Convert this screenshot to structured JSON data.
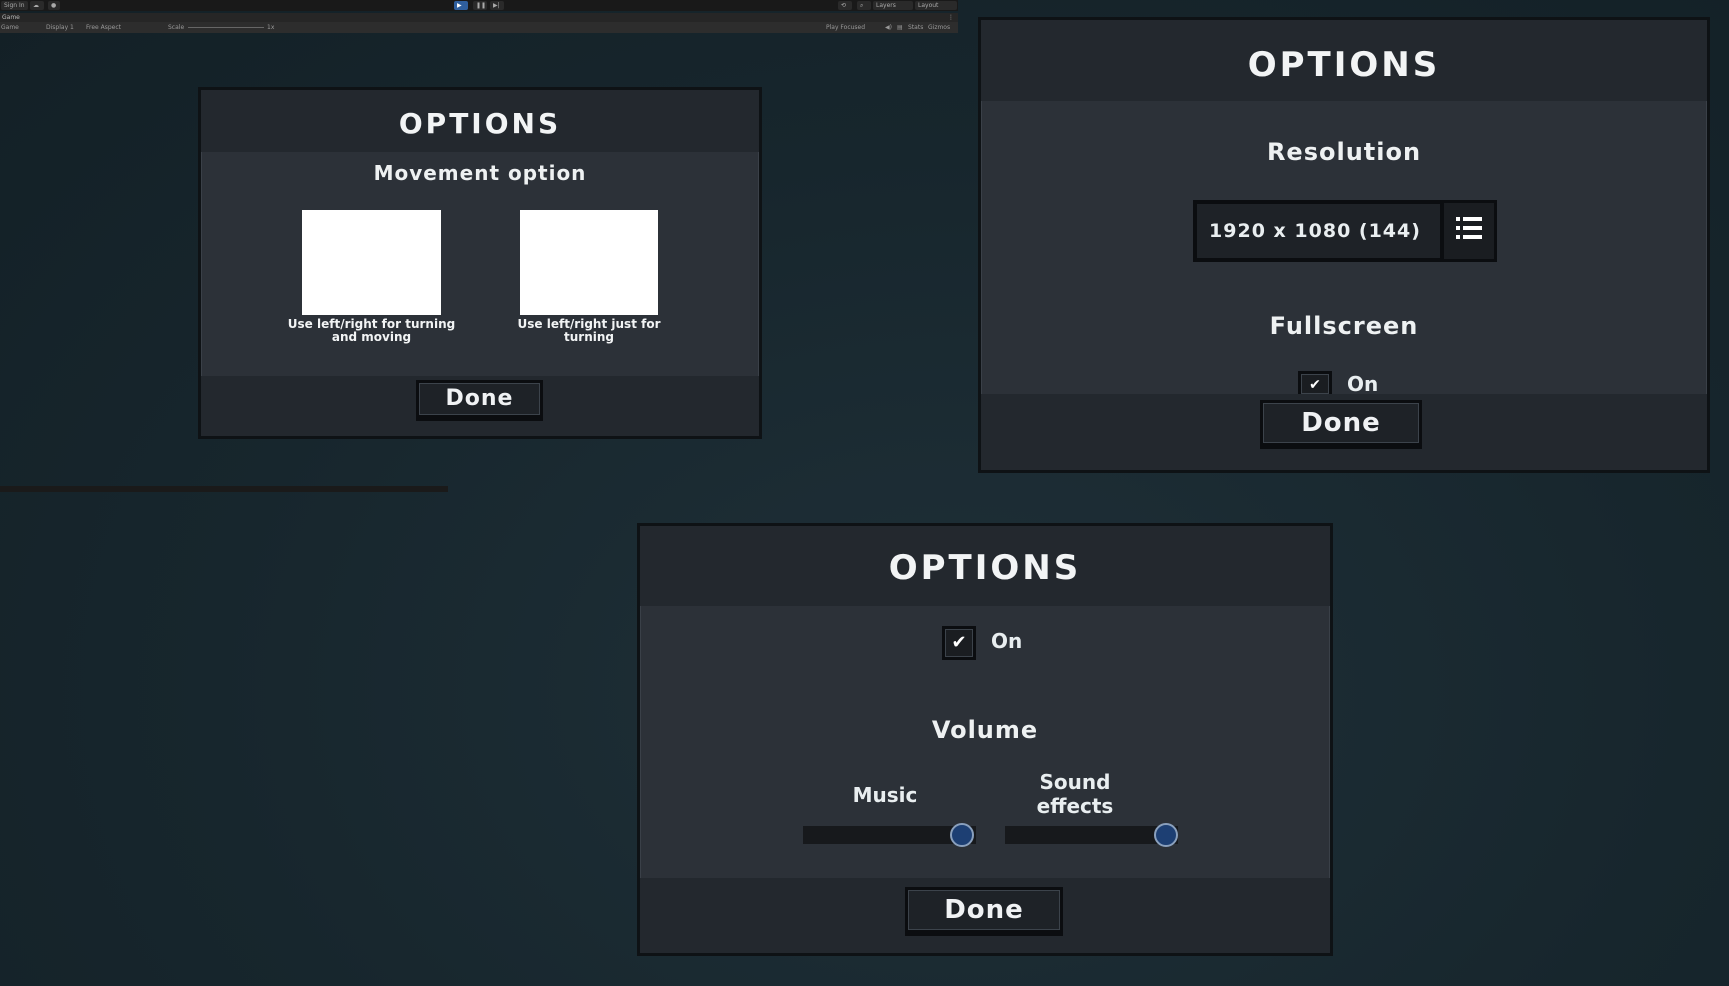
{
  "editor": {
    "sign_in": "Sign In",
    "layers": "Layers",
    "layout": "Layout",
    "tab_game": "Game",
    "game_view": "Game",
    "display": "Display 1",
    "aspect": "Free Aspect",
    "scale_label": "Scale",
    "scale_value": "1x",
    "play_focused": "Play Focused",
    "stats": "Stats",
    "gizmos": "Gizmos"
  },
  "panel_movement": {
    "title": "OPTIONS",
    "section": "Movement option",
    "option_a": "Use left/right for turning and moving",
    "option_b": "Use left/right just for turning",
    "done": "Done"
  },
  "panel_display": {
    "title": "OPTIONS",
    "resolution_label": "Resolution",
    "resolution_value": "1920 x 1080 (144)",
    "fullscreen_label": "Fullscreen",
    "fullscreen_on": "On",
    "done": "Done"
  },
  "panel_audio": {
    "title": "OPTIONS",
    "checkbox_label": "On",
    "volume_label": "Volume",
    "music_label": "Music",
    "sfx_label": "Sound effects",
    "music_level": 0.92,
    "sfx_level": 0.93,
    "done": "Done"
  },
  "colors": {
    "panel": "#2c3138",
    "header": "#23282e",
    "knob": "#1d3f73",
    "background": "#17262d"
  }
}
